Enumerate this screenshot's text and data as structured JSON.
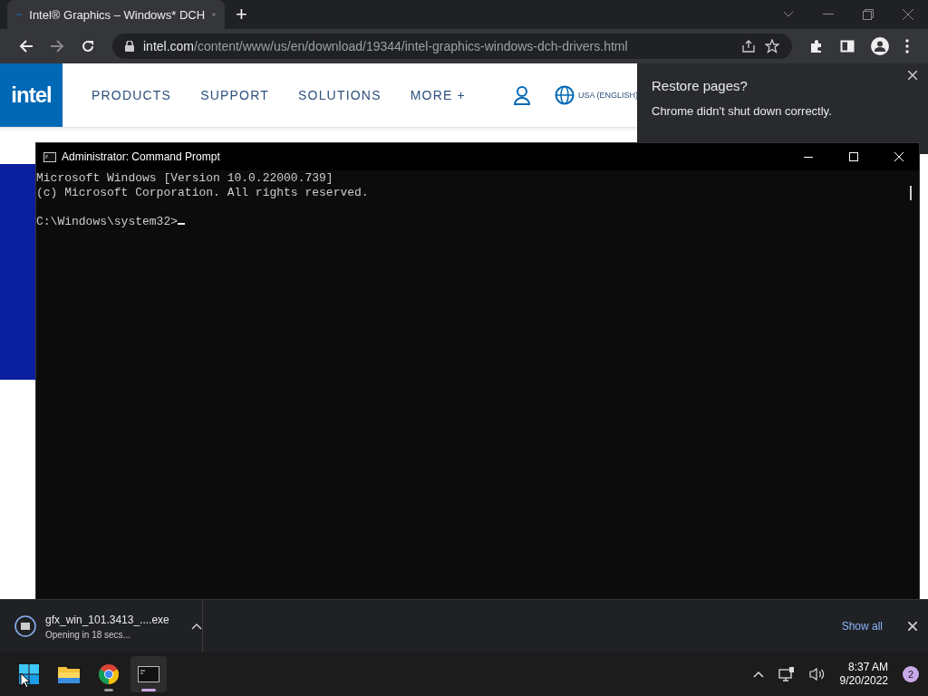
{
  "browser": {
    "tab": {
      "title": "Intel® Graphics – Windows* DCH",
      "selected": true
    },
    "new_tab": "+",
    "address": {
      "domain": "intel.com",
      "path": "/content/www/us/en/download/19344/intel-graphics-windows-dch-drivers.html"
    }
  },
  "site": {
    "logo": "intel",
    "nav": [
      "PRODUCTS",
      "SUPPORT",
      "SOLUTIONS",
      "MORE +"
    ],
    "region": "USA (ENGLISH)"
  },
  "restore_popup": {
    "title": "Restore pages?",
    "message": "Chrome didn't shut down correctly."
  },
  "console": {
    "title": "Administrator: Command Prompt",
    "lines": [
      "Microsoft Windows [Version 10.0.22000.739]",
      "(c) Microsoft Corporation. All rights reserved."
    ],
    "prompt": "C:\\Windows\\system32>"
  },
  "download": {
    "file": "gfx_win_101.3413_....exe",
    "status": "Opening in 18 secs...",
    "show_all": "Show all"
  },
  "taskbar": {
    "apps": [
      {
        "kind": "files",
        "running": false
      },
      {
        "kind": "browser",
        "running": true
      },
      {
        "kind": "terminal",
        "running": true
      }
    ],
    "time": "8:37 AM",
    "date": "9/20/2022",
    "notifications": "2"
  }
}
